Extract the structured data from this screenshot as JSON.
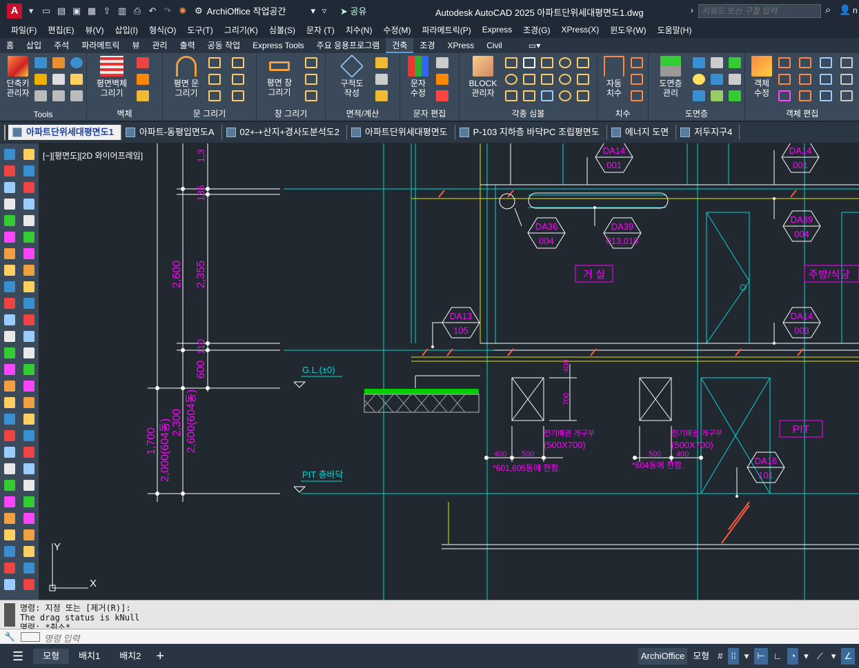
{
  "app": {
    "logo_letter": "A",
    "workspace_label": "ArchiOffice 작업공간",
    "share_label": "공유",
    "title": "Autodesk AutoCAD 2025   아파트단위세대평면도1.dwg",
    "search_placeholder": "키워드 또는 구절 입력",
    "user_initial": "n"
  },
  "menubar": [
    "파일(F)",
    "편집(E)",
    "뷰(V)",
    "삽입(I)",
    "형식(O)",
    "도구(T)",
    "그리기(K)",
    "심볼(S)",
    "문자 (T)",
    "치수(N)",
    "수정(M)",
    "파라메트릭(P)",
    "Express",
    "조경(G)",
    "XPress(X)",
    "윈도우(W)",
    "도움말(H)"
  ],
  "ribbon_tabs": [
    "홈",
    "삽입",
    "주석",
    "파라메트릭",
    "뷰",
    "관리",
    "출력",
    "공동 작업",
    "Express Tools",
    "주요 응용프로그램",
    "건축",
    "조경",
    "XPress",
    "Civil"
  ],
  "active_ribbon_tab": "건축",
  "ribbon_panels": [
    {
      "label": "Tools",
      "buttons": [
        "단축키\n관리자"
      ]
    },
    {
      "label": "벽체",
      "buttons": [
        "평면벽체\n그리기"
      ]
    },
    {
      "label": "문 그리기",
      "buttons": [
        "평면 문\n그리기"
      ]
    },
    {
      "label": "창 그리기",
      "buttons": [
        "평면 창\n그리기"
      ]
    },
    {
      "label": "면적/계산",
      "buttons": [
        "구적도\n작성"
      ]
    },
    {
      "label": "문자 편집",
      "buttons": [
        "문자\n수정"
      ]
    },
    {
      "label": "각종 심볼",
      "buttons": [
        "BLOCK\n관리자"
      ]
    },
    {
      "label": "치수",
      "buttons": [
        "자동\n치수"
      ]
    },
    {
      "label": "도면층",
      "buttons": [
        "도면층\n관리"
      ]
    },
    {
      "label": "객체 편집",
      "buttons": [
        "객체\n수정"
      ]
    }
  ],
  "doc_tabs": [
    "아파트단위세대평면도1",
    "아파트-동평입면도A",
    "02+-+산지+경사도분석도2",
    "아파트단위세대평면도",
    "P-103 지하층 바닥PC 조립평면도",
    "에너지 도면",
    "저두지구4"
  ],
  "active_doc_tab": "아파트단위세대평면도1",
  "viewport_label": "[−][평면도][2D 와이어프레임]",
  "drawing": {
    "dims_left": [
      "2,600",
      "2,355",
      "1,700",
      "2,000(604동)",
      "2,300",
      "2,600(604동)",
      "600",
      "110",
      "135",
      "1,3"
    ],
    "gl_label": "G.L.(±0)",
    "pit_floor_label": "PIT 층바닥",
    "tags": [
      {
        "top": "DA14",
        "bottom": "001"
      },
      {
        "top": "DA14",
        "bottom": "001"
      },
      {
        "top": "DA36",
        "bottom": "004"
      },
      {
        "top": "DA39",
        "bottom": "013,018"
      },
      {
        "top": "DA39",
        "bottom": "004"
      },
      {
        "top": "DA13",
        "bottom": "105"
      },
      {
        "top": "DA14",
        "bottom": "003"
      },
      {
        "top": "DA16",
        "bottom": "101"
      }
    ],
    "room_living": "거 실",
    "room_kitchen": "주방/식당",
    "pit_label": "PIT",
    "elec_note1": "전기배관 개구부",
    "elec_size1": "(500X700)",
    "elec_apply1": "*601,605동에 한함.",
    "elec_note2": "전기배관 개구부",
    "elec_size2": "(500X700)",
    "elec_apply2": "*604동에 한함.",
    "small_dims": [
      "400",
      "500",
      "500",
      "400",
      "400",
      "700"
    ],
    "axis_y": "Y",
    "axis_x": "X"
  },
  "command": {
    "history": [
      "명령: 지정 또는 [제거(R)]:",
      "The drag status is kNull",
      "명령: *취소*"
    ],
    "placeholder": "명령 입력"
  },
  "status": {
    "layout_tabs": [
      "모형",
      "배치1",
      "배치2"
    ],
    "active_layout": "모형",
    "add_label": "+",
    "archioffice": "ArchiOffice",
    "model": "모형"
  },
  "colors": {
    "magenta": "#ff00ff",
    "cyan": "#00d8d8",
    "white": "#ffffff",
    "yellow": "#e8e800",
    "hatch": "#00cc00",
    "red": "#ff5a3c"
  }
}
